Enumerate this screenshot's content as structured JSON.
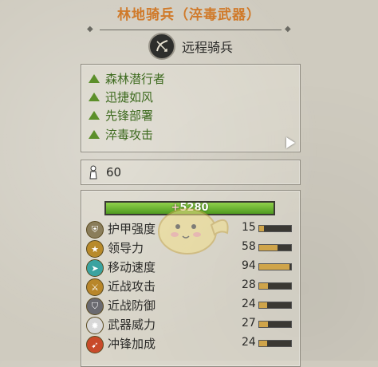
{
  "title": "林地骑兵（淬毒武器）",
  "unit_type": {
    "label": "远程骑兵",
    "icon": "ranged-cavalry-icon"
  },
  "traits": [
    {
      "label": "森林潜行者"
    },
    {
      "label": "迅捷如风"
    },
    {
      "label": "先锋部署"
    },
    {
      "label": "淬毒攻击"
    }
  ],
  "upkeep": {
    "icon": "upkeep-icon",
    "value": "60"
  },
  "health": {
    "value": "5280"
  },
  "stats": [
    {
      "label": "护甲强度",
      "value": "15",
      "icon": "armor-icon",
      "fill": 0.15,
      "color": "#8a7d5a"
    },
    {
      "label": "领导力",
      "value": "58",
      "icon": "leadership-icon",
      "fill": 0.58,
      "color": "#b88a2a"
    },
    {
      "label": "移动速度",
      "value": "94",
      "icon": "speed-icon",
      "fill": 0.94,
      "color": "#3aa3a0"
    },
    {
      "label": "近战攻击",
      "value": "28",
      "icon": "melee-attack-icon",
      "fill": 0.28,
      "color": "#b8862a"
    },
    {
      "label": "近战防御",
      "value": "24",
      "icon": "melee-defence-icon",
      "fill": 0.24,
      "color": "#6a6a70"
    },
    {
      "label": "武器威力",
      "value": "27",
      "icon": "weapon-strength-icon",
      "fill": 0.27,
      "color": "#d8d8d8"
    },
    {
      "label": "冲锋加成",
      "value": "24",
      "icon": "charge-bonus-icon",
      "fill": 0.24,
      "color": "#c84a2a"
    }
  ]
}
